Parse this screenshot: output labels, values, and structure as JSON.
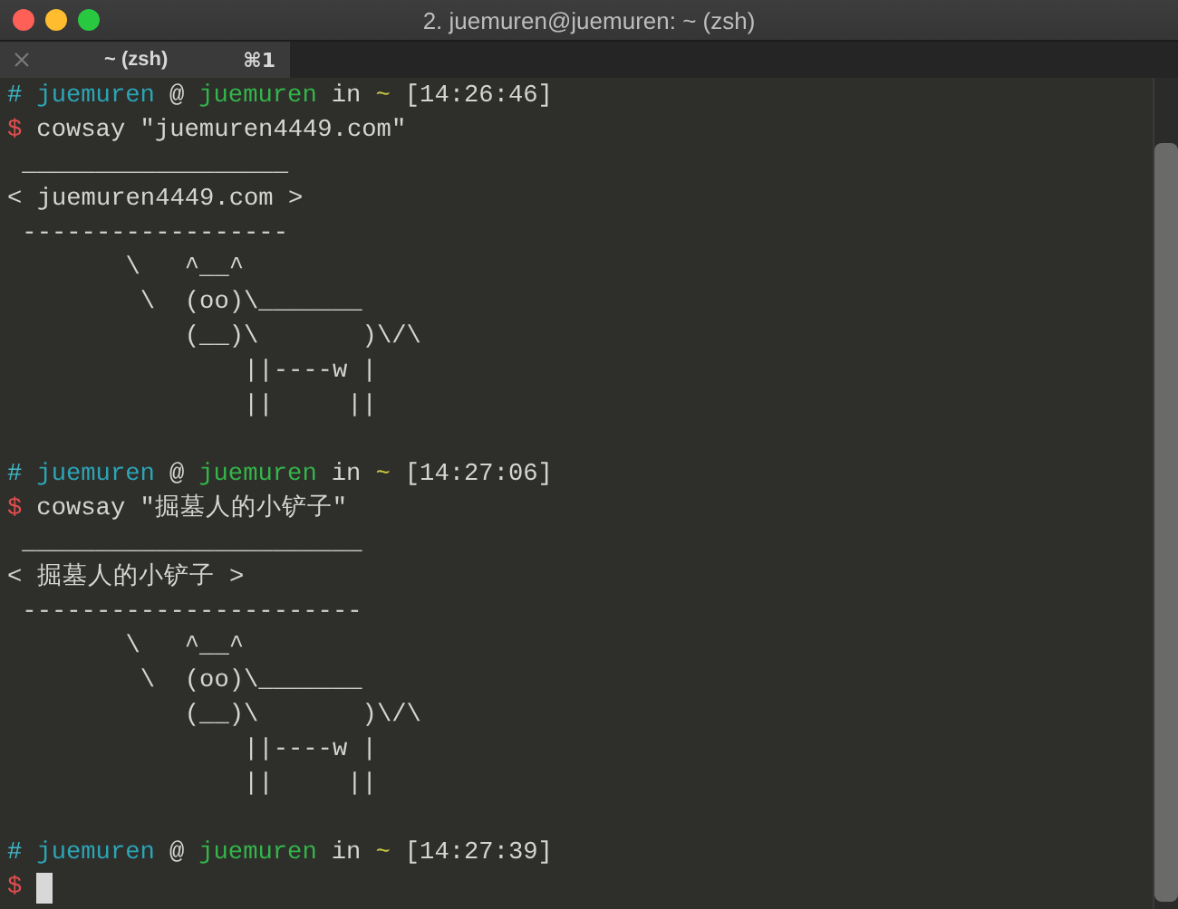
{
  "window": {
    "title": "2. juemuren@juemuren: ~ (zsh)"
  },
  "tabs": [
    {
      "label": "~ (zsh)",
      "shortcut": "⌘1",
      "selected": true
    }
  ],
  "terminal": {
    "lines": [
      {
        "kind": "prompt",
        "parts": [
          {
            "kind": "hash",
            "text": "#"
          },
          {
            "kind": "user",
            "text": "juemuren"
          },
          {
            "kind": "plain",
            "text": "@"
          },
          {
            "kind": "host",
            "text": "juemuren"
          },
          {
            "kind": "plain",
            "text": "in"
          },
          {
            "kind": "dir",
            "text": "~"
          },
          {
            "kind": "plain",
            "text": "[14:26:46]"
          }
        ]
      },
      {
        "kind": "command",
        "prompt": "$",
        "text": "cowsay \"juemuren4449.com\""
      },
      {
        "kind": "output",
        "text": " __________________"
      },
      {
        "kind": "output",
        "text": "< juemuren4449.com >"
      },
      {
        "kind": "output",
        "text": " ------------------"
      },
      {
        "kind": "output",
        "text": "        \\   ^__^"
      },
      {
        "kind": "output",
        "text": "         \\  (oo)\\_______"
      },
      {
        "kind": "output",
        "text": "            (__)\\       )\\/\\"
      },
      {
        "kind": "output",
        "text": "                ||----w |"
      },
      {
        "kind": "output",
        "text": "                ||     ||"
      },
      {
        "kind": "blank"
      },
      {
        "kind": "prompt",
        "parts": [
          {
            "kind": "hash",
            "text": "#"
          },
          {
            "kind": "user",
            "text": "juemuren"
          },
          {
            "kind": "plain",
            "text": "@"
          },
          {
            "kind": "host",
            "text": "juemuren"
          },
          {
            "kind": "plain",
            "text": "in"
          },
          {
            "kind": "dir",
            "text": "~"
          },
          {
            "kind": "plain",
            "text": "[14:27:06]"
          }
        ]
      },
      {
        "kind": "command",
        "prompt": "$",
        "text": "cowsay \"掘墓人的小铲子\""
      },
      {
        "kind": "output",
        "text": " _______________________"
      },
      {
        "kind": "output",
        "text": "< 掘墓人的小铲子 >"
      },
      {
        "kind": "output",
        "text": " -----------------------"
      },
      {
        "kind": "output",
        "text": "        \\   ^__^"
      },
      {
        "kind": "output",
        "text": "         \\  (oo)\\_______"
      },
      {
        "kind": "output",
        "text": "            (__)\\       )\\/\\"
      },
      {
        "kind": "output",
        "text": "                ||----w |"
      },
      {
        "kind": "output",
        "text": "                ||     ||"
      },
      {
        "kind": "blank"
      },
      {
        "kind": "prompt",
        "parts": [
          {
            "kind": "hash",
            "text": "#"
          },
          {
            "kind": "user",
            "text": "juemuren"
          },
          {
            "kind": "plain",
            "text": "@"
          },
          {
            "kind": "host",
            "text": "juemuren"
          },
          {
            "kind": "plain",
            "text": "in"
          },
          {
            "kind": "dir",
            "text": "~"
          },
          {
            "kind": "plain",
            "text": "[14:27:39]"
          }
        ]
      },
      {
        "kind": "command",
        "prompt": "$",
        "cursor": true
      }
    ]
  }
}
